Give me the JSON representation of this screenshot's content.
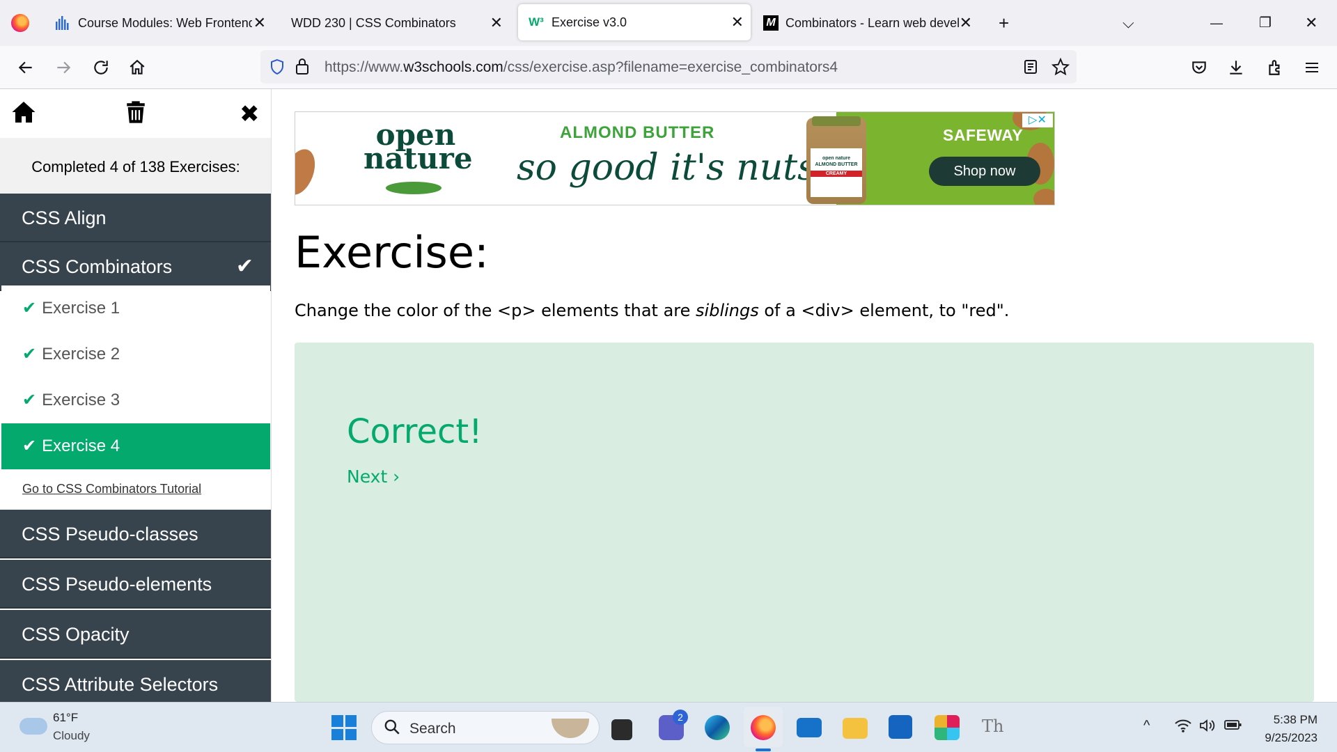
{
  "browser": {
    "tabs": [
      {
        "title": "Course Modules: Web Frontend",
        "close": "✕"
      },
      {
        "title": "WDD 230 | CSS Combinators",
        "close": "✕"
      },
      {
        "title": "Exercise v3.0",
        "close": "✕"
      },
      {
        "title": "Combinators - Learn web devel",
        "close": "✕"
      }
    ],
    "new_tab": "+",
    "list_all_tabs": "⌵",
    "window": {
      "minimize": "—",
      "restore": "❐",
      "close": "✕"
    },
    "url_prefix": "https://www.",
    "url_host": "w3schools.com",
    "url_path": "/css/exercise.asp?filename=exercise_combinators4",
    "tab_favicons": {
      "tab3": "W³",
      "tab4": "M"
    }
  },
  "sidebar": {
    "progress": "Completed 4 of 138 Exercises:",
    "categories": [
      {
        "label": "CSS Align"
      },
      {
        "label": "CSS Combinators",
        "check": "✔"
      },
      {
        "label": "CSS Pseudo-classes"
      },
      {
        "label": "CSS Pseudo-elements"
      },
      {
        "label": "CSS Opacity"
      },
      {
        "label": "CSS Attribute Selectors"
      }
    ],
    "exercises": [
      {
        "label": "Exercise 1"
      },
      {
        "label": "Exercise 2"
      },
      {
        "label": "Exercise 3"
      },
      {
        "label": "Exercise 4"
      }
    ],
    "check_glyph": "✔",
    "tutorial_link": "Go to CSS Combinators Tutorial",
    "accent": "#04aa6d",
    "dark": "#38444d"
  },
  "ad": {
    "brand": "open nature",
    "headline": "ALMOND BUTTER",
    "tagline": "so good it's nuts.",
    "jar_brand": "open nature",
    "jar_product": "ALMOND BUTTER",
    "jar_variant": "CREAMY",
    "sponsor": "SAFEWAY",
    "cta": "Shop now",
    "adchoices": "▷✕"
  },
  "exercise": {
    "title": "Exercise:",
    "desc_part1": "Change the color of the <p> elements that are ",
    "desc_em": "siblings",
    "desc_part2": " of a <div> element, to \"red\".",
    "result": "Correct!",
    "next": "Next ›"
  },
  "taskbar": {
    "temp": "61°F",
    "condition": "Cloudy",
    "search": "Search",
    "teams_badge": "2",
    "time": "5:38 PM",
    "date": "9/25/2023",
    "tray_overflow": "^"
  }
}
